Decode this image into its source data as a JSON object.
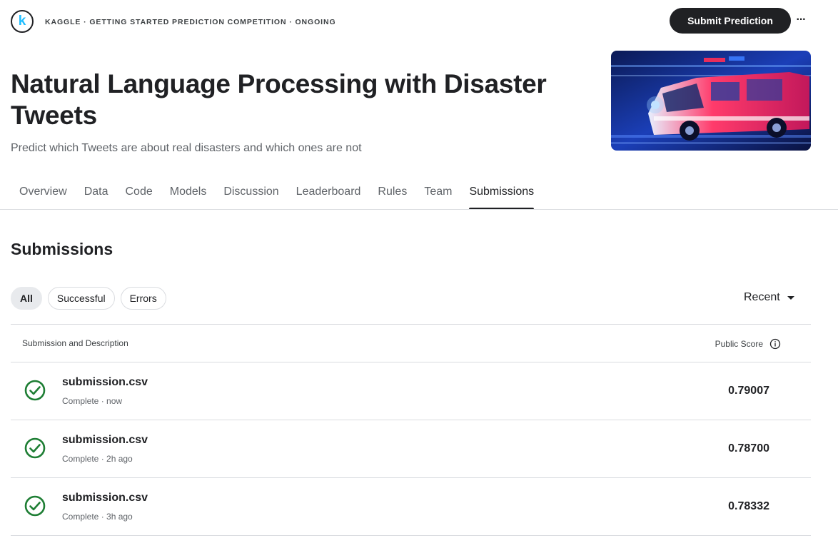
{
  "header": {
    "logo_letter": "k",
    "breadcrumb": "KAGGLE · GETTING STARTED PREDICTION COMPETITION · ONGOING",
    "submit_label": "Submit Prediction",
    "more_label": "···"
  },
  "competition": {
    "title": "Natural Language Processing with Disaster Tweets",
    "subtitle": "Predict which Tweets are about real disasters and which ones are not"
  },
  "tabs": [
    {
      "label": "Overview",
      "active": false
    },
    {
      "label": "Data",
      "active": false
    },
    {
      "label": "Code",
      "active": false
    },
    {
      "label": "Models",
      "active": false
    },
    {
      "label": "Discussion",
      "active": false
    },
    {
      "label": "Leaderboard",
      "active": false
    },
    {
      "label": "Rules",
      "active": false
    },
    {
      "label": "Team",
      "active": false
    },
    {
      "label": "Submissions",
      "active": true
    }
  ],
  "submissions": {
    "title": "Submissions",
    "filters": [
      {
        "label": "All",
        "active": true
      },
      {
        "label": "Successful",
        "active": false
      },
      {
        "label": "Errors",
        "active": false
      }
    ],
    "sort_label": "Recent",
    "columns": {
      "left": "Submission and Description",
      "right": "Public Score"
    },
    "rows": [
      {
        "file": "submission.csv",
        "meta": "Complete · now",
        "score": "0.79007"
      },
      {
        "file": "submission.csv",
        "meta": "Complete · 2h ago",
        "score": "0.78700"
      },
      {
        "file": "submission.csv",
        "meta": "Complete · 3h ago",
        "score": "0.78332"
      }
    ]
  },
  "colors": {
    "accent": "#20beff",
    "success": "#1e7e34",
    "text": "#202124"
  }
}
